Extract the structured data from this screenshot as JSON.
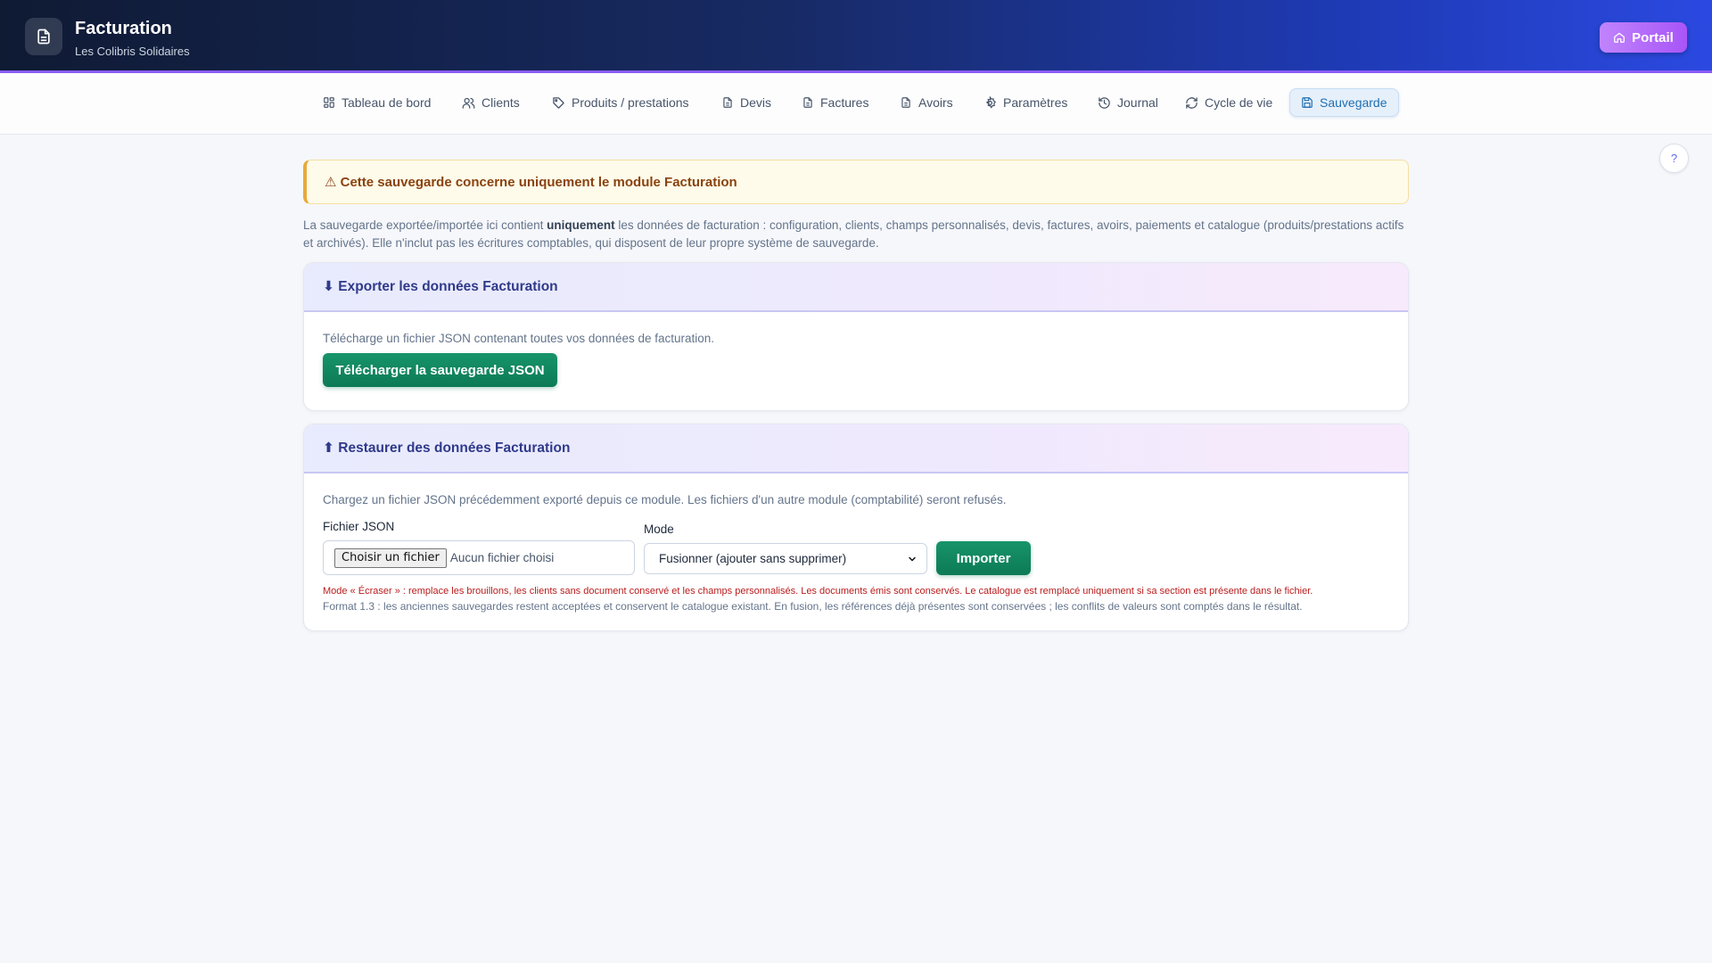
{
  "header": {
    "title": "Facturation",
    "subtitle": "Les Colibris Solidaires",
    "portal_label": "Portail"
  },
  "nav": {
    "items": [
      {
        "label": "Tableau de bord",
        "icon": "dashboard-icon"
      },
      {
        "label": "Clients",
        "icon": "users-icon"
      },
      {
        "label": "Produits / prestations",
        "icon": "tag-icon"
      },
      {
        "label": "Devis",
        "icon": "file-icon"
      },
      {
        "label": "Factures",
        "icon": "file-icon"
      },
      {
        "label": "Avoirs",
        "icon": "file-icon"
      },
      {
        "label": "Paramètres",
        "icon": "gear-icon"
      },
      {
        "label": "Journal",
        "icon": "history-icon"
      },
      {
        "label": "Cycle de vie",
        "icon": "refresh-icon"
      },
      {
        "label": "Sauvegarde",
        "icon": "save-icon",
        "active": true
      }
    ]
  },
  "help_label": "?",
  "warning": {
    "text": "⚠ Cette sauvegarde concerne uniquement le module Facturation"
  },
  "intro": {
    "before": "La sauvegarde exportée/importée ici contient ",
    "bold": "uniquement",
    "after": " les données de facturation : configuration, clients, champs personnalisés, devis, factures, avoirs, paiements et catalogue (produits/prestations actifs et archivés). Elle n'inclut pas les écritures comptables, qui disposent de leur propre système de sauvegarde."
  },
  "export": {
    "title": "⬇ Exporter les données Facturation",
    "description": "Télécharge un fichier JSON contenant toutes vos données de facturation.",
    "button_label": "Télécharger la sauvegarde JSON"
  },
  "restore": {
    "title": "⬆ Restaurer des données Facturation",
    "description": "Chargez un fichier JSON précédemment exporté depuis ce module. Les fichiers d'un autre module (comptabilité) seront refusés.",
    "file_label": "Fichier JSON",
    "file_button": "Choisir un fichier",
    "file_status": "Aucun fichier choisi",
    "mode_label": "Mode",
    "mode_value": "Fusionner (ajouter sans supprimer)",
    "import_label": "Importer",
    "note_overwrite": "Mode « Écraser » : remplace les brouillons, les clients sans document conservé et les champs personnalisés. Les documents émis sont conservés. Le catalogue est remplacé uniquement si sa section est présente dans le fichier.",
    "note_format": "Format 1.3 : les anciennes sauvegardes restent acceptées et conservent le catalogue existant. En fusion, les références déjà présentes sont conservées ; les conflits de valeurs sont comptés dans le résultat."
  },
  "colors": {
    "accent": "#1f6fb2",
    "primary_green": "#0c7a55",
    "warning_border": "#e8a93a",
    "portal_purple": "#a855f7"
  }
}
